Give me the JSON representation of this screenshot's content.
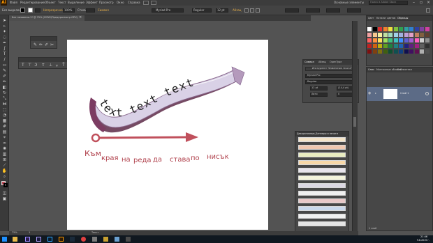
{
  "app": {
    "logo": "Ai",
    "menu": [
      "Файл",
      "Редактирование",
      "Объект",
      "Текст",
      "Выделение",
      "Эффект",
      "Просмотр",
      "Окно",
      "Справка"
    ],
    "workspace": "Основные элементы",
    "search_placeholder": "Поиск в Adobe Stock"
  },
  "control_bar": {
    "selection_label": "Без выделения",
    "opacity_label": "Непрозрачность",
    "opacity_value": "100%",
    "style_label": "Стиль",
    "char_label": "Символ",
    "font": "Myriad Pro",
    "font_style": "Regular",
    "font_size": "12 pt",
    "paragraph_label": "Абзац"
  },
  "doc_tab": {
    "title": "Без названия-1* @ 75% (CMYK/Предпросмотр GPU)",
    "close_glyph": "×"
  },
  "canvas": {
    "path_text": "text text text",
    "line_words": [
      "Към",
      "края",
      "на",
      "реда",
      "да",
      "става",
      "по",
      "нисък"
    ]
  },
  "char_panel": {
    "tabs": [
      "Символ",
      "Абзац",
      "OpenType"
    ],
    "touch_label": "Инструмент \"Изменение текста\"",
    "font": "Myriad Pro",
    "style": "Regular",
    "size": "12 pt",
    "leading": "(14,4 pt)",
    "kerning": "Авто",
    "tracking": "0"
  },
  "brushes_panel": {
    "title": "Декоративные_Баннеры и печати"
  },
  "layers_panel": {
    "tabs": [
      "Слои",
      "Монтажные области",
      "Библиотеки"
    ],
    "layer_name": "Слой 1",
    "footer": "1 слой"
  },
  "swatches_panel": {
    "tabs": [
      "Цвет",
      "Каталог цветов",
      "Образцы"
    ]
  },
  "status": {
    "zoom": "75%",
    "page": "1",
    "tool": "Текст"
  },
  "taskbar": {
    "time": "21:46",
    "date": "9.8.2015 г."
  },
  "colors": {
    "text_red": "#b0414c",
    "arrow_red": "#c0505c",
    "banner_lavender": "#d8d2e4",
    "banner_dark": "#6a3252",
    "panel_bg": "#474747",
    "canvas_bg": "#535353"
  }
}
